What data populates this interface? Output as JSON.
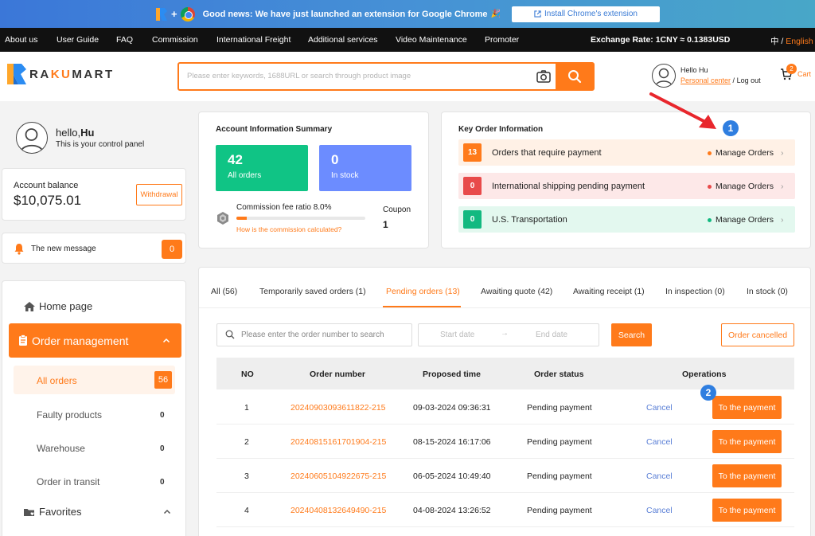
{
  "banner": {
    "news": "Good news: We have just launched an extension for Google Chrome",
    "party": "🎉",
    "button": "Install Chrome's extension"
  },
  "topnav": {
    "items": [
      "About us",
      "User Guide",
      "FAQ",
      "Commission",
      "International Freight",
      "Additional services",
      "Video Maintenance",
      "Promoter"
    ],
    "rate": "Exchange Rate: 1CNY ≈ 0.1383USD",
    "lang_zh": "中",
    "lang_sep": " / ",
    "lang_en": "English"
  },
  "header": {
    "logo_r": "R",
    "logo_a": "A",
    "logo_ku": "KU",
    "logo_mart": "MART",
    "search_placeholder": "Please enter keywords, 1688URL or search through product image",
    "hello": "Hello Hu",
    "personal_center": "Personal center",
    "logout_sep": " / ",
    "logout": "Log out",
    "cart_count": "2",
    "cart_label": "Cart"
  },
  "profile": {
    "hello_prefix": "hello,",
    "name": "Hu",
    "subtitle": "This is your control panel"
  },
  "balance": {
    "label": "Account balance",
    "amount": "$10,075.01",
    "withdraw": "Withdrawal"
  },
  "message": {
    "label": "The new message",
    "count": "0"
  },
  "sidenav": {
    "home": "Home page",
    "order_management": "Order management",
    "all_orders": "All orders",
    "all_orders_count": "56",
    "subitems": [
      {
        "label": "Faulty products",
        "count": "0"
      },
      {
        "label": "Warehouse",
        "count": "0"
      },
      {
        "label": "Order in transit",
        "count": "0"
      }
    ],
    "favorites": "Favorites"
  },
  "summary": {
    "title": "Account Information Summary",
    "all_orders_num": "42",
    "all_orders_label": "All orders",
    "in_stock_num": "0",
    "in_stock_label": "In stock",
    "commission": "Commission fee ratio 8.0%",
    "commission_ratio": 0.08,
    "how": "How is the commission calculated?",
    "coupon_label": "Coupon",
    "coupon_value": "1"
  },
  "key_info": {
    "title": "Key Order Information",
    "rows": [
      {
        "num": "13",
        "label": "Orders that require payment",
        "action": "Manage Orders",
        "color": "#ff7a1a",
        "bg": "#fff1e6"
      },
      {
        "num": "0",
        "label": "International shipping pending payment",
        "action": "Manage Orders",
        "color": "#e84a4a",
        "bg": "#fde8e8"
      },
      {
        "num": "0",
        "label": "U.S. Transportation",
        "action": "Manage Orders",
        "color": "#12b980",
        "bg": "#e3f8ef"
      }
    ]
  },
  "orders": {
    "tabs": [
      "All (56)",
      "Temporarily saved orders (1)",
      "Pending orders (13)",
      "Awaiting quote (42)",
      "Awaiting receipt (1)",
      "In inspection (0)",
      "In stock (0)"
    ],
    "active_tab": 2,
    "search_placeholder": "Please enter the order number to search",
    "start_date": "Start date",
    "date_arrow": "→",
    "end_date": "End date",
    "search_btn": "Search",
    "cancelled_btn": "Order cancelled",
    "columns": [
      "NO",
      "Order number",
      "Proposed time",
      "Order status",
      "Operations"
    ],
    "rows": [
      {
        "no": "1",
        "order": "20240903093611822-215",
        "time": "09-03-2024 09:36:31",
        "status": "Pending payment",
        "cancel": "Cancel",
        "pay": "To the payment"
      },
      {
        "no": "2",
        "order": "20240815161701904-215",
        "time": "08-15-2024 16:17:06",
        "status": "Pending payment",
        "cancel": "Cancel",
        "pay": "To the payment"
      },
      {
        "no": "3",
        "order": "20240605104922675-215",
        "time": "06-05-2024 10:49:40",
        "status": "Pending payment",
        "cancel": "Cancel",
        "pay": "To the payment"
      },
      {
        "no": "4",
        "order": "20240408132649490-215",
        "time": "04-08-2024 13:26:52",
        "status": "Pending payment",
        "cancel": "Cancel",
        "pay": "To the payment"
      }
    ]
  },
  "annotations": {
    "step1": "1",
    "step2": "2",
    "color": "#2f7ee0",
    "arrow_color": "#e8262c"
  },
  "colors": {
    "accent": "#ff7a1a",
    "green": "#10c485",
    "blue": "#6c8cff"
  }
}
